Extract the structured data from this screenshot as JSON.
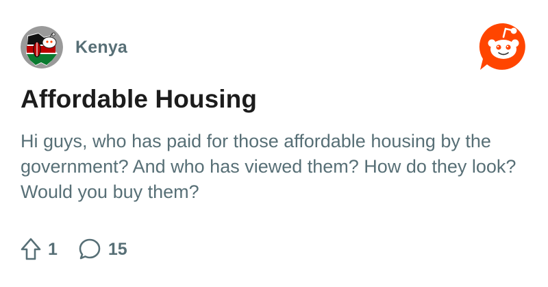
{
  "post": {
    "subreddit": "Kenya",
    "title": "Affordable Housing",
    "body": "Hi guys, who has paid for those affordable housing by the government? And who has viewed them? How do they look? Would you buy them?",
    "upvotes": "1",
    "comments": "15"
  },
  "icons": {
    "subreddit_avatar": "kenya-flag-snoo-icon",
    "brand": "reddit-logo-icon",
    "upvote": "upvote-arrow-icon",
    "comment": "comment-bubble-icon"
  },
  "colors": {
    "brand_orange": "#ff4500",
    "muted_text": "#576f76",
    "title_text": "#1c1c1c",
    "flag_black": "#111111",
    "flag_red": "#bb0000",
    "flag_green": "#0a7a2f",
    "avatar_bg": "#9a9a9a"
  }
}
